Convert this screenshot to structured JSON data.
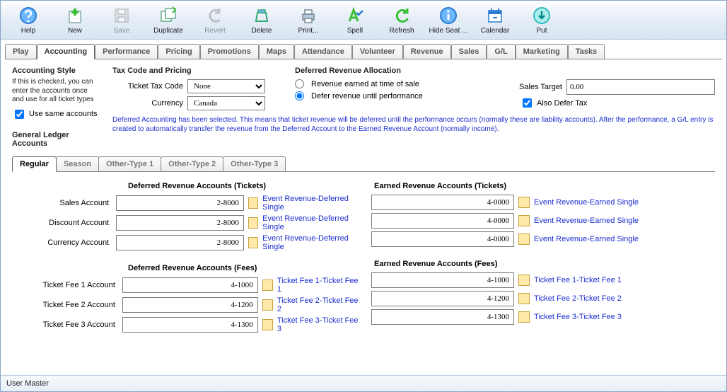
{
  "toolbar": [
    {
      "name": "help-button",
      "label": "Help",
      "icon": "help",
      "enabled": true
    },
    {
      "name": "new-button",
      "label": "New",
      "icon": "plus",
      "enabled": true
    },
    {
      "name": "save-button",
      "label": "Save",
      "icon": "save",
      "enabled": false
    },
    {
      "name": "duplicate-button",
      "label": "Duplicate",
      "icon": "duplicate",
      "enabled": true
    },
    {
      "name": "revert-button",
      "label": "Revert",
      "icon": "revert",
      "enabled": false
    },
    {
      "name": "delete-button",
      "label": "Delete",
      "icon": "delete",
      "enabled": true
    },
    {
      "name": "print-button",
      "label": "Print...",
      "icon": "print",
      "enabled": true
    },
    {
      "name": "spell-button",
      "label": "Spell",
      "icon": "spell",
      "enabled": true
    },
    {
      "name": "refresh-button",
      "label": "Refresh",
      "icon": "refresh",
      "enabled": true
    },
    {
      "name": "hideseat-button",
      "label": "Hide Seat ...",
      "icon": "info",
      "enabled": true
    },
    {
      "name": "calendar-button",
      "label": "Calendar",
      "icon": "calendar",
      "enabled": true
    },
    {
      "name": "put-button",
      "label": "Put",
      "icon": "put",
      "enabled": true
    }
  ],
  "tabs": [
    "Play",
    "Accounting",
    "Performance",
    "Pricing",
    "Promotions",
    "Maps",
    "Attendance",
    "Volunteer",
    "Revenue",
    "Sales",
    "G/L",
    "Marketing",
    "Tasks"
  ],
  "activeTab": "Accounting",
  "style": {
    "heading": "Accounting Style",
    "help": "If this is checked, you can enter the accounts once and use for all ticket types",
    "useSameLabel": "Use same accounts",
    "useSameChecked": true
  },
  "tax": {
    "heading": "Tax Code and Pricing",
    "ticketTaxLabel": "Ticket Tax Code",
    "ticketTaxValue": "None",
    "currencyLabel": "Currency",
    "currencyValue": "Canada"
  },
  "deferred": {
    "heading": "Deferred Revenue Allocation",
    "optEarned": "Revenue earned at time of sale",
    "optDefer": "Defer revenue until performance",
    "selected": "defer",
    "salesTargetLabel": "Sales Target",
    "salesTargetValue": "0.00",
    "alsoDeferLabel": "Also Defer Tax",
    "alsoDeferChecked": true,
    "note": "Deferred Accounting has been selected.  This means that ticket revenue will be deferred until the performance occurs (normally these are liability accounts). After the performance, a G/L entry is created to automatically transfer the revenue from the Deferred Account to the Earned Revenue Account (normally income)."
  },
  "glHeading": "General Ledger Accounts",
  "subtabs": [
    "Regular",
    "Season",
    "Other-Type 1",
    "Other-Type 2",
    "Other-Type 3"
  ],
  "activeSubtab": "Regular",
  "sections": {
    "deferredTickets": "Deferred Revenue Accounts (Tickets)",
    "earnedTickets": "Earned Revenue Accounts (Tickets)",
    "deferredFees": "Deferred Revenue Accounts (Fees)",
    "earnedFees": "Earned Revenue Accounts (Fees)"
  },
  "rows": {
    "sales": {
      "label": "Sales Account",
      "dval": "2-8000",
      "dlink": "Event Revenue-Deferred Single",
      "eval": "4-0000",
      "elink": "Event Revenue-Earned Single"
    },
    "discount": {
      "label": "Discount Account",
      "dval": "2-8000",
      "dlink": "Event Revenue-Deferred Single",
      "eval": "4-0000",
      "elink": "Event Revenue-Earned Single"
    },
    "currency": {
      "label": "Currency Account",
      "dval": "2-8000",
      "dlink": "Event Revenue-Deferred Single",
      "eval": "4-0000",
      "elink": "Event Revenue-Earned Single"
    },
    "fee1": {
      "label": "Ticket Fee 1 Account",
      "dval": "4-1000",
      "dlink": "Ticket Fee 1-Ticket Fee 1",
      "eval": "4-1000",
      "elink": "Ticket Fee 1-Ticket Fee 1"
    },
    "fee2": {
      "label": "Ticket Fee 2 Account",
      "dval": "4-1200",
      "dlink": "Ticket Fee 2-Ticket Fee 2",
      "eval": "4-1200",
      "elink": "Ticket Fee 2-Ticket Fee 2"
    },
    "fee3": {
      "label": "Ticket Fee 3 Account",
      "dval": "4-1300",
      "dlink": "Ticket Fee 3-Ticket Fee 3",
      "eval": "4-1300",
      "elink": "Ticket Fee 3-Ticket Fee 3"
    }
  },
  "status": "User Master"
}
